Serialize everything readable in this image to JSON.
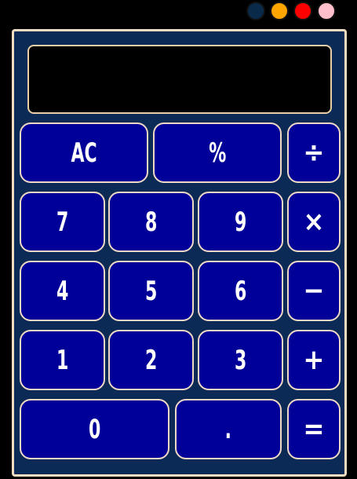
{
  "window": {
    "dots": [
      {
        "name": "dot-navy",
        "color": "#0a2a4a"
      },
      {
        "name": "dot-orange",
        "color": "#ffa500"
      },
      {
        "name": "dot-red",
        "color": "#ff0000"
      },
      {
        "name": "dot-pink",
        "color": "#ffc0cb"
      }
    ]
  },
  "display": {
    "value": ""
  },
  "keys": {
    "ac": "AC",
    "percent": "%",
    "divide": "÷",
    "seven": "7",
    "eight": "8",
    "nine": "9",
    "multiply": "×",
    "four": "4",
    "five": "5",
    "six": "6",
    "subtract": "−",
    "one": "1",
    "two": "2",
    "three": "3",
    "add": "+",
    "zero": "0",
    "decimal": ".",
    "equals": "="
  },
  "colors": {
    "background": "#000000",
    "calculator_body": "#0b2a55",
    "calculator_border": "#f3dcc0",
    "key_fill": "#000099",
    "key_border": "#efd8c5",
    "display_fill": "#000000"
  }
}
